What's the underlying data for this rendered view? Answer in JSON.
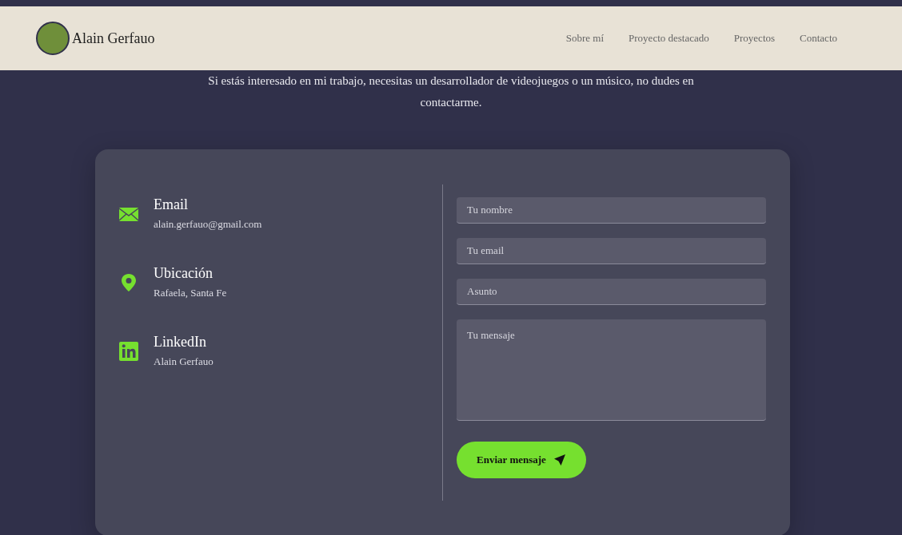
{
  "header": {
    "name": "Alain Gerfauo"
  },
  "nav": [
    {
      "label": "Sobre mí"
    },
    {
      "label": "Proyecto destacado"
    },
    {
      "label": "Proyectos"
    },
    {
      "label": "Contacto"
    }
  ],
  "intro": "Si estás interesado en mi trabajo, necesitas un desarrollador de videojuegos o un músico, no dudes en contactarme.",
  "contacts": [
    {
      "kind": "email",
      "title": "Email",
      "value": "alain.gerfauo@gmail.com"
    },
    {
      "kind": "location",
      "title": "Ubicación",
      "value": "Rafaela, Santa Fe"
    },
    {
      "kind": "linkedin",
      "title": "LinkedIn",
      "value": "Alain Gerfauo"
    }
  ],
  "form": {
    "fields": [
      {
        "kind": "input",
        "placeholder": "Tu nombre"
      },
      {
        "kind": "input",
        "placeholder": "Tu email"
      },
      {
        "kind": "input",
        "placeholder": "Asunto"
      },
      {
        "kind": "textarea",
        "placeholder": "Tu mensaje"
      }
    ],
    "submit": "Enviar mensaje"
  }
}
